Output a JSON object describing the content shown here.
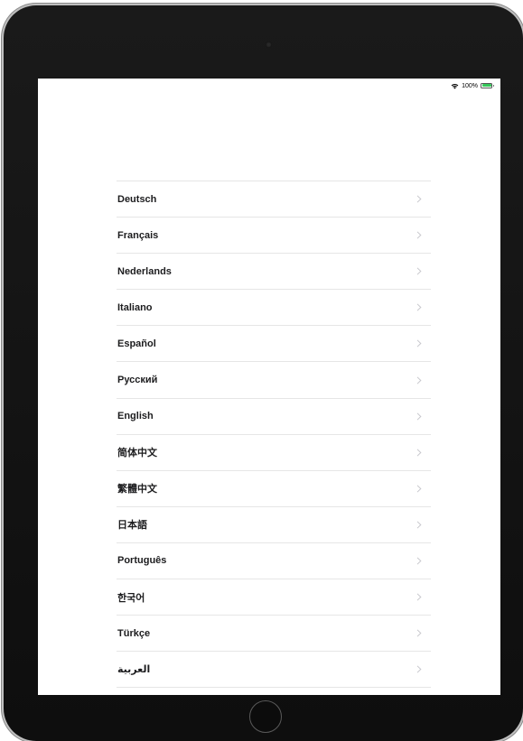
{
  "status_bar": {
    "battery_percent": "100%",
    "battery_level": 1.0,
    "wifi_icon": "wifi-icon",
    "battery_icon": "battery-icon",
    "battery_color": "#35c759"
  },
  "languages": [
    {
      "label": "Deutsch"
    },
    {
      "label": "Français"
    },
    {
      "label": "Nederlands"
    },
    {
      "label": "Italiano"
    },
    {
      "label": "Español"
    },
    {
      "label": "Русский"
    },
    {
      "label": "English"
    },
    {
      "label": "简体中文"
    },
    {
      "label": "繁體中文"
    },
    {
      "label": "日本語"
    },
    {
      "label": "Português"
    },
    {
      "label": "한국어"
    },
    {
      "label": "Türkçe"
    },
    {
      "label": "العربية"
    }
  ],
  "row_icon": "chevron-right-icon",
  "colors": {
    "text": "#1c1c1e",
    "separator": "#e6e6e6",
    "chevron": "#c7c7cc",
    "bezel": "#111111"
  }
}
